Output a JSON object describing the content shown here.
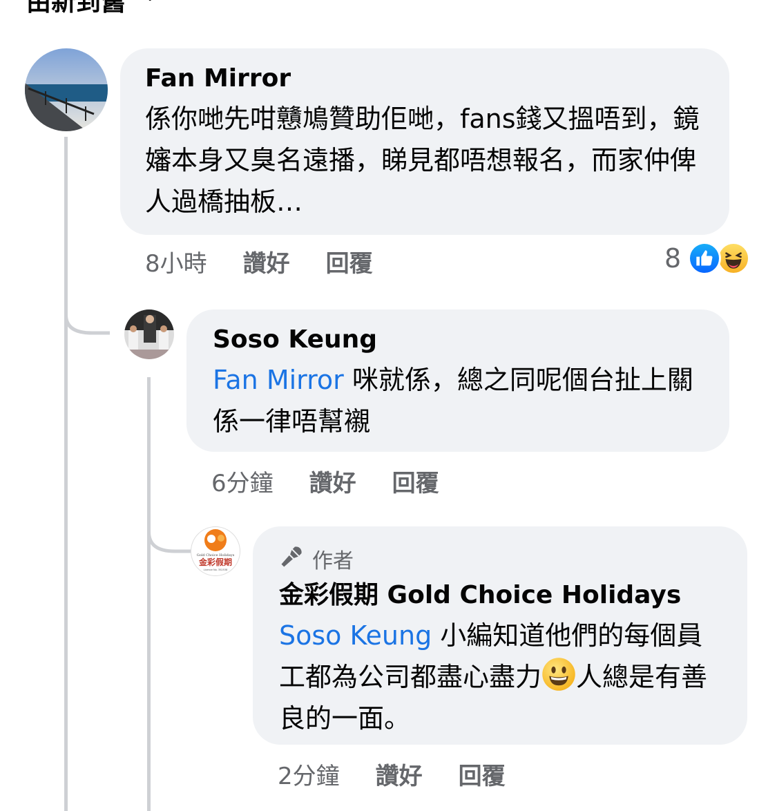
{
  "sort": {
    "label": "由新到舊"
  },
  "comments": [
    {
      "author": "Fan Mirror",
      "text": "係你哋先咁戇鳩贊助佢哋，fans錢又搵唔到，鏡嬸本身又臭名遠播，睇見都唔想報名，而家仲俾人過橋抽板…",
      "time": "8小時",
      "like_label": "讚好",
      "reply_label": "回覆",
      "reaction_count": "8",
      "reactions": [
        "like-icon",
        "haha-icon"
      ]
    },
    {
      "author": "Soso Keung",
      "mention": "Fan Mirror",
      "text": " 咪就係，總之同呢個台扯上關係一律唔幫襯",
      "time": "6分鐘",
      "like_label": "讚好",
      "reply_label": "回覆"
    },
    {
      "badge": "作者",
      "author": "金彩假期 Gold Choice Holidays",
      "mention": "Soso Keung",
      "text_before_emoji": " 小編知道他們的每個員工都為公司都盡心盡力",
      "emoji": "smile-emoji",
      "text_after_emoji": "人總是有善良的一面。",
      "time": "2分鐘",
      "like_label": "讚好",
      "reply_label": "回覆",
      "logo_text": {
        "line1": "Gold Choice Holidays",
        "line2": "金彩假期",
        "line3": "Licence No. 352538"
      }
    }
  ],
  "colors": {
    "link": "#1b74e4",
    "bubble": "#f0f2f5",
    "meta": "#65676b",
    "thread": "#ced0d4"
  }
}
